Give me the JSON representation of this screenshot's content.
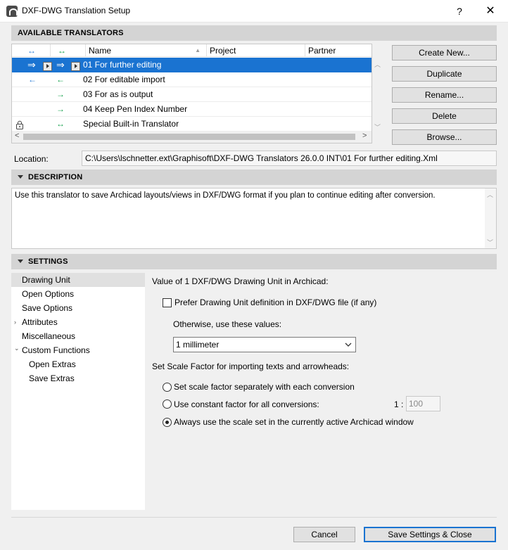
{
  "window": {
    "title": "DXF-DWG Translation Setup",
    "help_label": "?",
    "close_label": "✕"
  },
  "translators": {
    "header": "AVAILABLE TRANSLATORS",
    "columns": {
      "col1_arrow": "↔",
      "col2_arrow": "↔",
      "name": "Name",
      "sort_indicator": "▲",
      "project": "Project",
      "partner": "Partner"
    },
    "rows": [
      {
        "arrow1": "⇒",
        "arrow2": "⇒",
        "name": "01 For further editing",
        "selected": true
      },
      {
        "arrow1": "←",
        "arrow2": "←",
        "name": "02 For editable import",
        "selected": false
      },
      {
        "arrow1": "",
        "arrow2": "→",
        "name": "03 For as is output",
        "selected": false
      },
      {
        "arrow1": "",
        "arrow2": "→",
        "name": "04 Keep Pen Index Number",
        "selected": false
      },
      {
        "arrow1": "lock",
        "arrow2": "↔",
        "name": "Special Built-in Translator",
        "selected": false
      }
    ],
    "scroll_left": "<",
    "scroll_right": ">",
    "scroll_up": "︿",
    "scroll_down": "﹀",
    "buttons": {
      "create_new": "Create New...",
      "duplicate": "Duplicate",
      "rename": "Rename...",
      "delete": "Delete",
      "browse": "Browse..."
    }
  },
  "location": {
    "label": "Location:",
    "value": "C:\\Users\\lschnetter.ext\\Graphisoft\\DXF-DWG Translators 26.0.0 INT\\01 For further editing.Xml"
  },
  "description": {
    "header": "DESCRIPTION",
    "text": "Use this translator to save Archicad layouts/views in DXF/DWG format if you plan to continue editing after conversion."
  },
  "settings": {
    "header": "SETTINGS",
    "nav": [
      {
        "label": "Drawing Unit",
        "selected": true,
        "caret": ""
      },
      {
        "label": "Open Options",
        "selected": false,
        "caret": ""
      },
      {
        "label": "Save Options",
        "selected": false,
        "caret": ""
      },
      {
        "label": "Attributes",
        "selected": false,
        "caret": "›"
      },
      {
        "label": "Miscellaneous",
        "selected": false,
        "caret": ""
      },
      {
        "label": "Custom Functions",
        "selected": false,
        "caret": "⌄"
      },
      {
        "label": "Open Extras",
        "selected": false,
        "caret": ""
      },
      {
        "label": "Save Extras",
        "selected": false,
        "caret": ""
      }
    ],
    "drawing_unit_title": "Value of 1 DXF/DWG Drawing Unit in Archicad:",
    "prefer_checkbox_label": "Prefer Drawing Unit definition in DXF/DWG file (if any)",
    "prefer_checked": false,
    "otherwise_label": "Otherwise, use these values:",
    "unit_value": "1 millimeter",
    "scale_title": "Set Scale Factor for importing texts and arrowheads:",
    "radio_separately": "Set scale factor separately with each conversion",
    "radio_constant": "Use constant factor for all conversions:",
    "radio_active": "Always use the scale set in the currently active Archicad window",
    "selected_radio": "active",
    "scale_prefix": "1 :",
    "scale_value": "100"
  },
  "footer": {
    "cancel": "Cancel",
    "save_close": "Save Settings & Close"
  },
  "colors": {
    "selection": "#1a73d1",
    "arrow_blue": "#2f7fd6",
    "arrow_green": "#19a34f"
  }
}
